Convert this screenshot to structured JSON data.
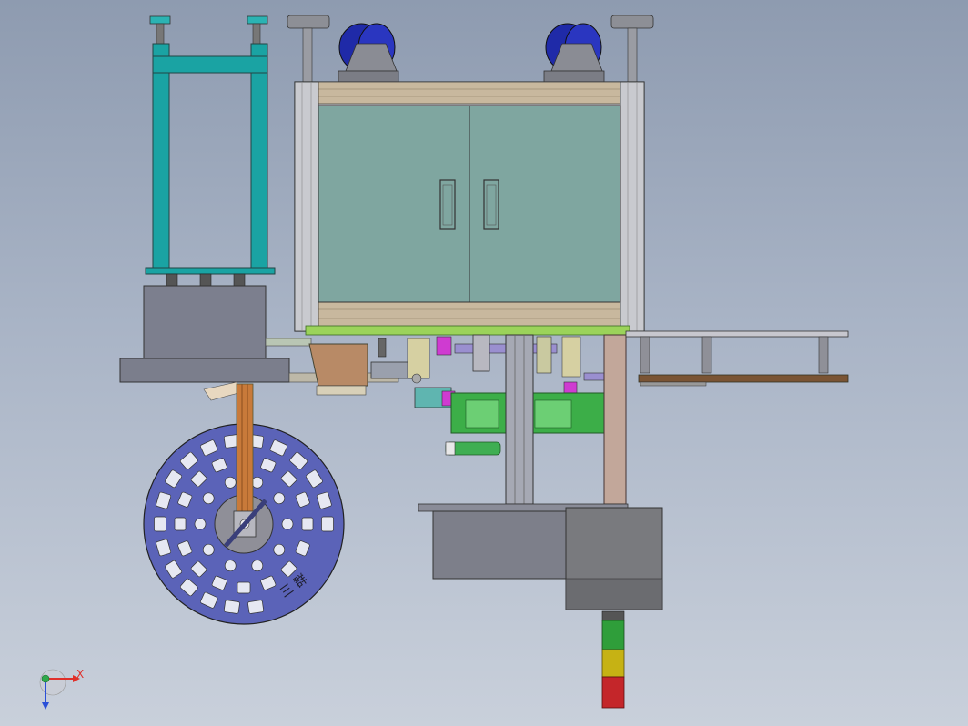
{
  "viewport": {
    "background_top": "#8e9bb0",
    "background_bottom": "#c9d0db"
  },
  "triad": {
    "x_label": "X",
    "x_color": "#e0302a",
    "y_color": "#2fa84a",
    "z_color": "#2a4fd8"
  },
  "reel": {
    "label": "三 群"
  },
  "colors": {
    "cabinet_frame": "#c3c3c8",
    "cabinet_glass": "#7fa6a0",
    "cabinet_panel": "#c8b89e",
    "teal_frame": "#1aa3a3",
    "reel_disk": "#5b63b8",
    "green_block": "#3cae48",
    "signal_green": "#2f9e3a",
    "signal_yellow": "#c6b214",
    "signal_red": "#c4262a",
    "caster_wheel": "#1f2aa8",
    "base_box": "#7d7f8a",
    "copper_arm": "#c87a3a"
  }
}
